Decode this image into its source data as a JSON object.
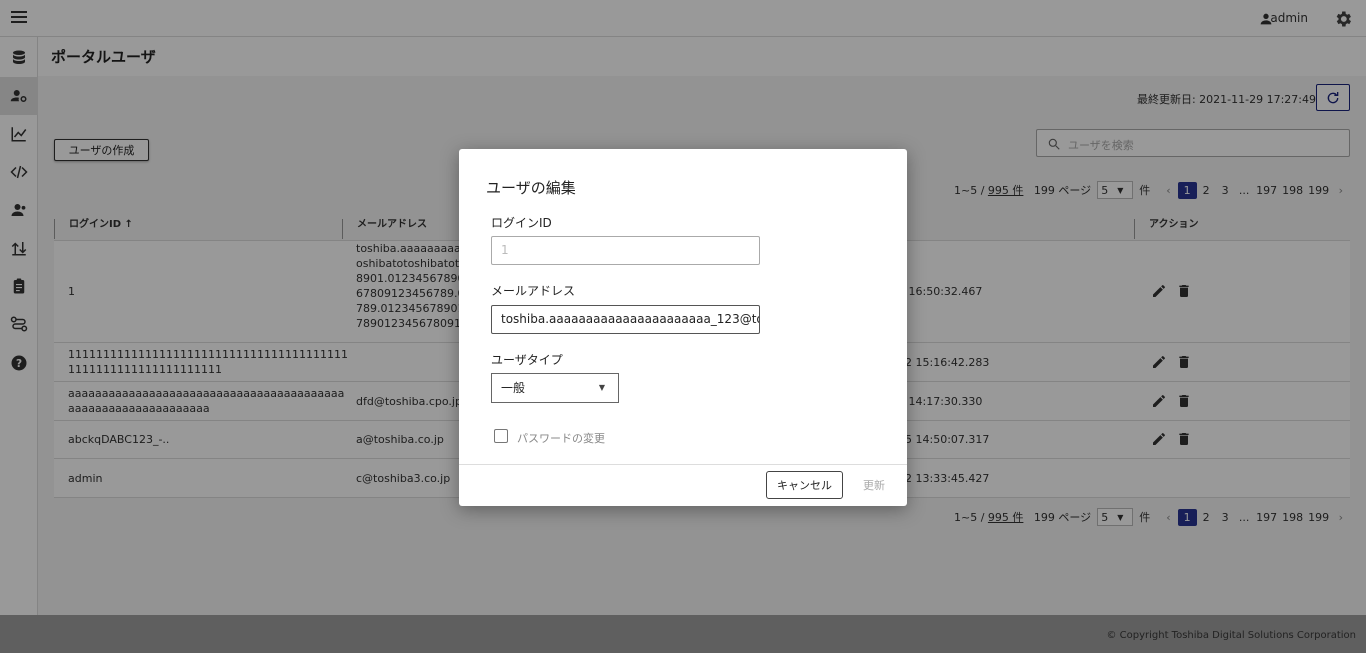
{
  "topbar": {
    "username": "admin"
  },
  "page": {
    "title": "ポータルユーザ"
  },
  "toolbar": {
    "updated_label": "最終更新日: 2021-11-29 17:27:49",
    "create_label": "ユーザの作成",
    "search_placeholder": "ユーザを検索"
  },
  "pager": {
    "range": "1~5 /",
    "total": "995 件",
    "pages_label": "199 ページ",
    "page_size": "5",
    "items_unit": "件",
    "current": "1",
    "p2": "2",
    "p3": "3",
    "ellipsis": "...",
    "p197": "197",
    "p198": "198",
    "p199": "199"
  },
  "table": {
    "headers": [
      "ログインID ↑",
      "メールアドレス",
      "アクション"
    ],
    "rows": [
      {
        "login": "1",
        "email": "toshiba.aaaaaaaaaaaa\noshibatotoshibatotos\n8901.012345678901\n67809123456789.01\n789.0123456789012\n78901234567809123",
        "updated": "1 16:50:32.467"
      },
      {
        "login": "1111111111111111111111111111111111111111\n1111111111111111111111",
        "email": "",
        "updated": "22 15:16:42.283"
      },
      {
        "login": "aaaaaaaaaaaaaaaaaaaaaaaaaaaaaaaaaaaaaaaaa\naaaaaaaaaaaaaaaaaaaaa",
        "email": "dfd@toshiba.cpo.jp",
        "updated": "5 14:17:30.330"
      },
      {
        "login": "abckqDABC123_-..",
        "email": "a@toshiba.co.jp",
        "updated": "05 14:50:07.317"
      },
      {
        "login": "admin",
        "email": "c@toshiba3.co.jp",
        "updated": "22 13:33:45.427"
      }
    ]
  },
  "dialog": {
    "title": "ユーザの編集",
    "login_label": "ログインID",
    "login_value": "1",
    "email_label": "メールアドレス",
    "email_value": "toshiba.aaaaaaaaaaaaaaaaaaaaaa_123@to",
    "type_label": "ユーザタイプ",
    "type_value": "一般",
    "password_label": "パスワードの変更",
    "cancel_label": "キャンセル",
    "update_label": "更新"
  },
  "footer": {
    "copyright": "© Copyright Toshiba Digital Solutions Corporation"
  }
}
